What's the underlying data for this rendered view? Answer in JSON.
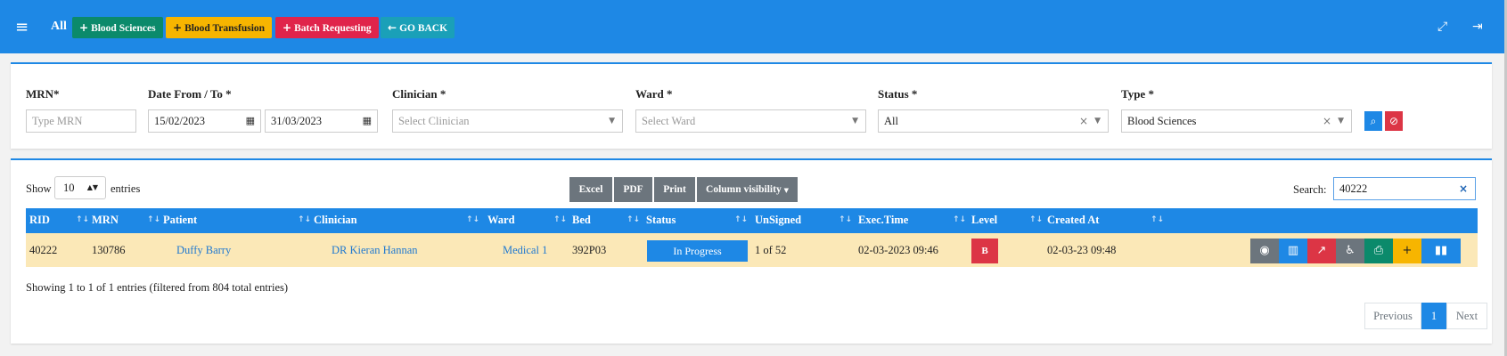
{
  "topbar": {
    "all_label": "All",
    "buttons": {
      "blood_sciences": "Blood Sciences",
      "blood_transfusion": "Blood Transfusion",
      "batch_requesting": "Batch Requesting",
      "go_back": "GO BACK"
    },
    "colors": {
      "bar": "#1e88e5",
      "green": "#0b8a6b",
      "yellow": "#f7b500",
      "red": "#e0244b",
      "teal": "#1aa0b8"
    }
  },
  "filters": {
    "mrn": {
      "label": "MRN*",
      "placeholder": "Type MRN"
    },
    "date": {
      "label": "Date From / To *",
      "from": "15/02/2023",
      "to": "31/03/2023"
    },
    "clinician": {
      "label": "Clinician *",
      "placeholder": "Select Clinician"
    },
    "ward": {
      "label": "Ward *",
      "placeholder": "Select Ward"
    },
    "status": {
      "label": "Status *",
      "value": "All"
    },
    "type": {
      "label": "Type *",
      "value": "Blood Sciences"
    }
  },
  "table_controls": {
    "show_label": "Show",
    "entries_value": "10",
    "entries_label": "entries",
    "export_buttons": {
      "excel": "Excel",
      "pdf": "PDF",
      "print": "Print",
      "column_visibility": "Column visibility"
    },
    "search_label": "Search:",
    "search_value": "40222"
  },
  "table": {
    "columns": {
      "rid": "RID",
      "mrn": "MRN",
      "patient": "Patient",
      "clinician": "Clinician",
      "ward": "Ward",
      "bed": "Bed",
      "status": "Status",
      "unsigned": "UnSigned",
      "exec_time": "Exec.Time",
      "level": "Level",
      "created_at": "Created At"
    },
    "row": {
      "rid": "40222",
      "mrn": "130786",
      "patient": "Duffy Barry",
      "clinician": "DR Kieran Hannan",
      "ward": "Medical 1",
      "bed": "392P03",
      "status": "In Progress",
      "unsigned": "1 of 52",
      "exec_time": "02-03-2023 09:46",
      "level": "B",
      "created_at": "02-03-23 09:48"
    },
    "row_actions": [
      "eye-icon",
      "bar-chart-icon",
      "line-chart-icon",
      "wheelchair-icon",
      "print-icon",
      "plus-icon",
      "barcode-icon"
    ]
  },
  "footer": {
    "info": "Showing 1 to 1 of 1 entries (filtered from 804 total entries)",
    "pagination": {
      "previous": "Previous",
      "page": "1",
      "next": "Next"
    }
  }
}
